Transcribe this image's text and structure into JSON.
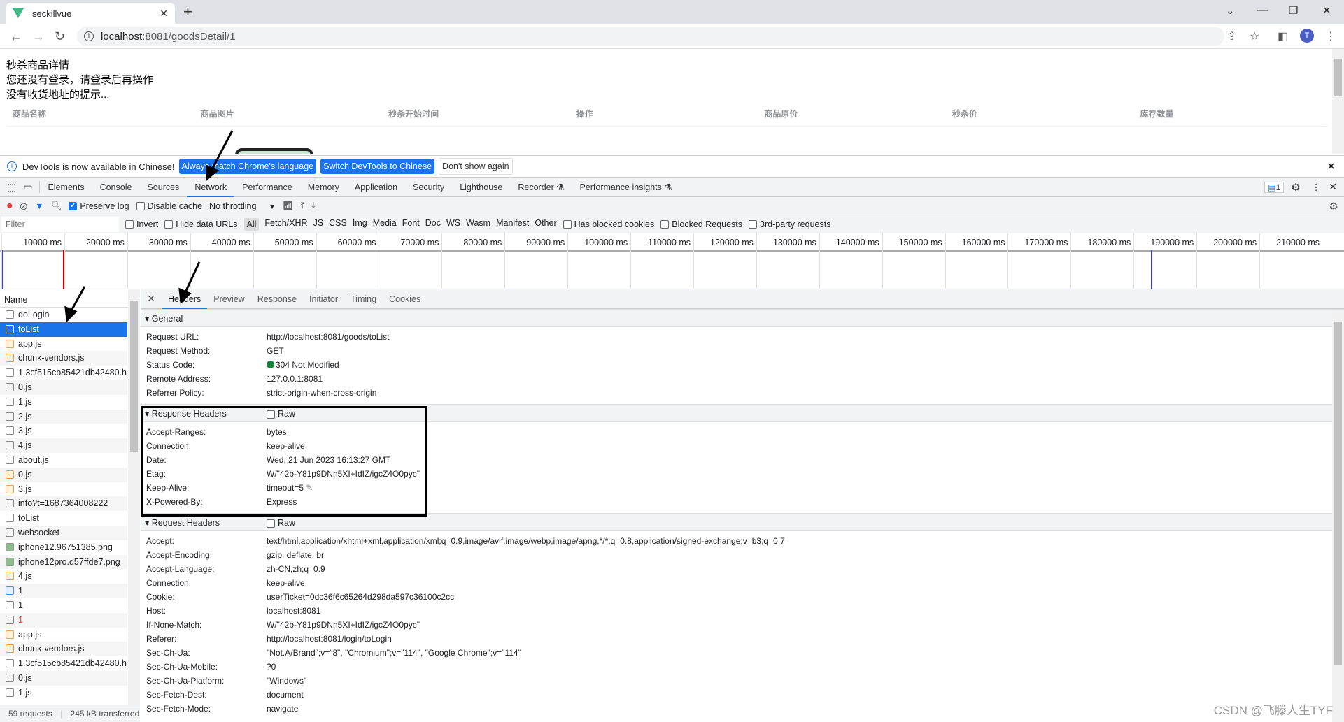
{
  "browser": {
    "tab_title": "seckillvue",
    "url_host": "localhost",
    "url_rest": ":8081/goodsDetail/1",
    "avatar_letter": "T",
    "brand_color": "#41b883"
  },
  "page": {
    "lines": [
      "秒杀商品详情",
      "您还没有登录，请登录后再操作",
      "没有收货地址的提示..."
    ],
    "table_headers": [
      "商品名称",
      "商品图片",
      "秒杀开始时间",
      "操作",
      "商品原价",
      "秒杀价",
      "库存数量"
    ]
  },
  "banner": {
    "text": "DevTools is now available in Chinese!",
    "btn1": "Always match Chrome's language",
    "btn2": "Switch DevTools to Chinese",
    "btn3": "Don't show again"
  },
  "devtools": {
    "tabs": [
      "Elements",
      "Console",
      "Sources",
      "Network",
      "Performance",
      "Memory",
      "Application",
      "Security",
      "Lighthouse",
      "Recorder ⚗",
      "Performance insights ⚗"
    ],
    "active_tab": "Network",
    "issues_count": "1"
  },
  "network_toolbar": {
    "preserve_log": "Preserve log",
    "preserve_log_checked": true,
    "disable_cache": "Disable cache",
    "disable_cache_checked": false,
    "throttling": "No throttling"
  },
  "filter": {
    "placeholder": "Filter",
    "invert": "Invert",
    "hide_data_urls": "Hide data URLs",
    "types": [
      "All",
      "Fetch/XHR",
      "JS",
      "CSS",
      "Img",
      "Media",
      "Font",
      "Doc",
      "WS",
      "Wasm",
      "Manifest",
      "Other"
    ],
    "active_type": "All",
    "has_blocked_cookies": "Has blocked cookies",
    "blocked_requests": "Blocked Requests",
    "third_party": "3rd-party requests"
  },
  "timeline": {
    "ticks": [
      "10000 ms",
      "20000 ms",
      "30000 ms",
      "40000 ms",
      "50000 ms",
      "60000 ms",
      "70000 ms",
      "80000 ms",
      "90000 ms",
      "100000 ms",
      "110000 ms",
      "120000 ms",
      "130000 ms",
      "140000 ms",
      "150000 ms",
      "160000 ms",
      "170000 ms",
      "180000 ms",
      "190000 ms",
      "200000 ms",
      "210000 ms"
    ]
  },
  "requests": {
    "header": "Name",
    "selected": "toList",
    "items": [
      {
        "name": "doLogin",
        "type": "other"
      },
      {
        "name": "toList",
        "type": "doc"
      },
      {
        "name": "app.js",
        "type": "script"
      },
      {
        "name": "chunk-vendors.js",
        "type": "script"
      },
      {
        "name": "1.3cf515cb85421db42480.h...",
        "type": "other"
      },
      {
        "name": "0.js",
        "type": "other"
      },
      {
        "name": "1.js",
        "type": "other"
      },
      {
        "name": "2.js",
        "type": "other"
      },
      {
        "name": "3.js",
        "type": "other"
      },
      {
        "name": "4.js",
        "type": "other"
      },
      {
        "name": "about.js",
        "type": "other"
      },
      {
        "name": "0.js",
        "type": "script"
      },
      {
        "name": "3.js",
        "type": "script"
      },
      {
        "name": "info?t=1687364008222",
        "type": "other"
      },
      {
        "name": "toList",
        "type": "other"
      },
      {
        "name": "websocket",
        "type": "other"
      },
      {
        "name": "iphone12.96751385.png",
        "type": "img"
      },
      {
        "name": "iphone12pro.d57ffde7.png",
        "type": "img"
      },
      {
        "name": "4.js",
        "type": "script"
      },
      {
        "name": "1",
        "type": "doc"
      },
      {
        "name": "1",
        "type": "other"
      },
      {
        "name": "1",
        "type": "error"
      },
      {
        "name": "app.js",
        "type": "script"
      },
      {
        "name": "chunk-vendors.js",
        "type": "script"
      },
      {
        "name": "1.3cf515cb85421db42480.h...",
        "type": "other"
      },
      {
        "name": "0.js",
        "type": "other"
      },
      {
        "name": "1.js",
        "type": "other"
      }
    ],
    "summary_count": "59 requests",
    "summary_transferred": "245 kB transferred"
  },
  "detail": {
    "tabs": [
      "Headers",
      "Preview",
      "Response",
      "Initiator",
      "Timing",
      "Cookies"
    ],
    "active_tab": "Headers",
    "general": {
      "title": "General",
      "rows": [
        [
          "Request URL:",
          "http://localhost:8081/goods/toList"
        ],
        [
          "Request Method:",
          "GET"
        ],
        [
          "Status Code:",
          "304 Not Modified"
        ],
        [
          "Remote Address:",
          "127.0.0.1:8081"
        ],
        [
          "Referrer Policy:",
          "strict-origin-when-cross-origin"
        ]
      ],
      "status_color": "#188038"
    },
    "response_headers": {
      "title": "Response Headers",
      "raw": "Raw",
      "rows": [
        [
          "Accept-Ranges:",
          "bytes"
        ],
        [
          "Connection:",
          "keep-alive"
        ],
        [
          "Date:",
          "Wed, 21 Jun 2023 16:13:27 GMT"
        ],
        [
          "Etag:",
          "W/\"42b-Y81p9DNn5XI+IdIZ/igcZ4O0pyc\""
        ],
        [
          "Keep-Alive:",
          "timeout=5"
        ],
        [
          "X-Powered-By:",
          "Express"
        ]
      ]
    },
    "request_headers": {
      "title": "Request Headers",
      "raw": "Raw",
      "rows": [
        [
          "Accept:",
          "text/html,application/xhtml+xml,application/xml;q=0.9,image/avif,image/webp,image/apng,*/*;q=0.8,application/signed-exchange;v=b3;q=0.7"
        ],
        [
          "Accept-Encoding:",
          "gzip, deflate, br"
        ],
        [
          "Accept-Language:",
          "zh-CN,zh;q=0.9"
        ],
        [
          "Connection:",
          "keep-alive"
        ],
        [
          "Cookie:",
          "userTicket=0dc36f6c65264d298da597c36100c2cc"
        ],
        [
          "Host:",
          "localhost:8081"
        ],
        [
          "If-None-Match:",
          "W/\"42b-Y81p9DNn5XI+IdIZ/igcZ4O0pyc\""
        ],
        [
          "Referer:",
          "http://localhost:8081/login/toLogin"
        ],
        [
          "Sec-Ch-Ua:",
          "\"Not.A/Brand\";v=\"8\", \"Chromium\";v=\"114\", \"Google Chrome\";v=\"114\""
        ],
        [
          "Sec-Ch-Ua-Mobile:",
          "?0"
        ],
        [
          "Sec-Ch-Ua-Platform:",
          "\"Windows\""
        ],
        [
          "Sec-Fetch-Dest:",
          "document"
        ],
        [
          "Sec-Fetch-Mode:",
          "navigate"
        ]
      ]
    }
  },
  "watermark": "CSDN @飞滕人生TYF"
}
